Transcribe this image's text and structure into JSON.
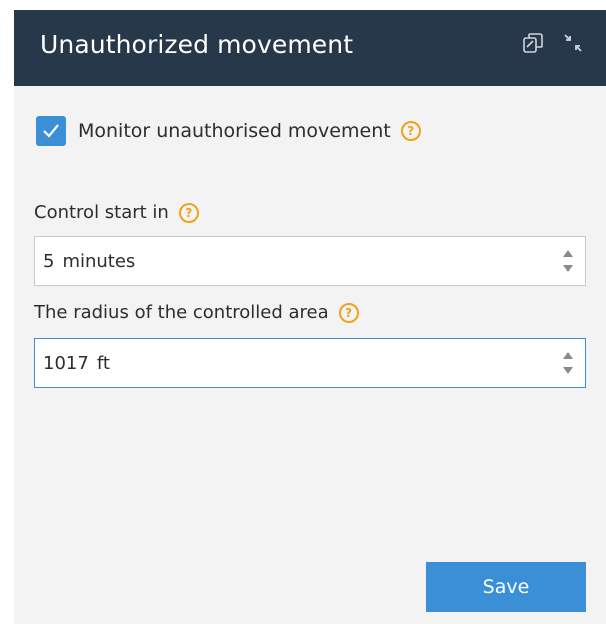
{
  "header": {
    "title": "Unauthorized movement",
    "icons": [
      "copy-icon",
      "collapse-icon"
    ]
  },
  "monitor": {
    "checked": true,
    "label": "Monitor unauthorised movement"
  },
  "control_start": {
    "label": "Control start in",
    "value": "5",
    "unit": "minutes"
  },
  "radius": {
    "label": "The radius of the controlled area",
    "value": "1017",
    "unit": "ft"
  },
  "actions": {
    "save_label": "Save"
  },
  "colors": {
    "header_bg": "#26384a",
    "accent": "#3a8fd6",
    "help": "#f0a21b"
  }
}
